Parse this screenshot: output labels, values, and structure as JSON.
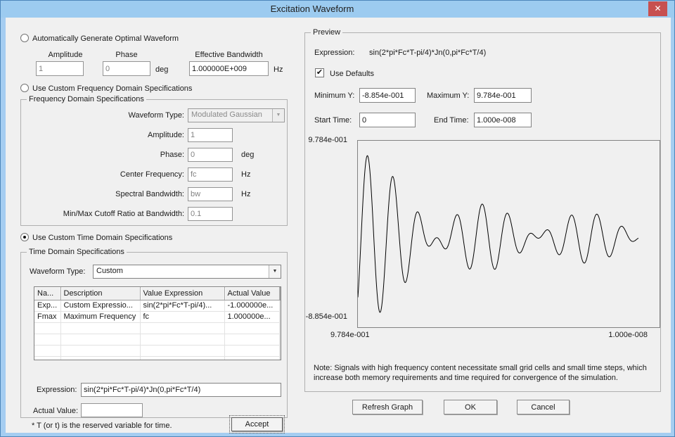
{
  "window": {
    "title": "Excitation Waveform"
  },
  "icons": {
    "close": "✕",
    "dropdown_arrow": "▼",
    "check": "✔"
  },
  "auto_section": {
    "radio_label": "Automatically Generate Optimal Waveform",
    "radio_selected": false,
    "amplitude_label": "Amplitude",
    "amplitude_value": "1",
    "phase_label": "Phase",
    "phase_value": "0",
    "deg_unit": "deg",
    "bandwidth_label": "Effective Bandwidth",
    "bandwidth_value": "1.000000E+009",
    "hz_unit": "Hz"
  },
  "freq_section": {
    "radio_label": "Use Custom Frequency Domain Specifications",
    "radio_selected": false,
    "group_title": "Frequency Domain Specifications",
    "waveform_type_label": "Waveform Type:",
    "waveform_type_value": "Modulated Gaussian",
    "amplitude_label": "Amplitude:",
    "amplitude_value": "1",
    "phase_label": "Phase:",
    "phase_value": "0",
    "phase_unit": "deg",
    "center_freq_label": "Center Frequency:",
    "center_freq_value": "fc",
    "center_freq_unit": "Hz",
    "spectral_bw_label": "Spectral Bandwidth:",
    "spectral_bw_value": "bw",
    "spectral_bw_unit": "Hz",
    "cutoff_label": "Min/Max Cutoff Ratio at Bandwidth:",
    "cutoff_value": "0.1"
  },
  "time_section": {
    "radio_label": "Use Custom Time Domain Specifications",
    "radio_selected": true,
    "group_title": "Time Domain Specifications",
    "waveform_type_label": "Waveform Type:",
    "waveform_type_value": "Custom",
    "table": {
      "columns": [
        "Na...",
        "Description",
        "Value Expression",
        "Actual Value"
      ],
      "rows": [
        [
          "Exp...",
          "Custom Expressio...",
          "sin(2*pi*Fc*T-pi/4)...",
          "-1.000000e..."
        ],
        [
          "Fmax",
          "Maximum Frequency",
          "fc",
          "1.000000e..."
        ]
      ],
      "empty_filler_rows": 5
    },
    "expression_label": "Expression:",
    "expression_value": "sin(2*pi*Fc*T-pi/4)*Jn(0,pi*Fc*T/4)",
    "actual_value_label": "Actual Value:",
    "actual_value_value": "",
    "footnote": "* T (or t) is the reserved variable for time.",
    "accept_button": "Accept"
  },
  "preview": {
    "group_title": "Preview",
    "expression_label": "Expression:",
    "expression_value": "sin(2*pi*Fc*T-pi/4)*Jn(0,pi*Fc*T/4)",
    "use_defaults_label": "Use Defaults",
    "use_defaults_checked": true,
    "min_y_label": "Minimum Y:",
    "min_y_value": "-8.854e-001",
    "max_y_label": "Maximum Y:",
    "max_y_value": "9.784e-001",
    "start_time_label": "Start Time:",
    "start_time_value": "0",
    "end_time_label": "End Time:",
    "end_time_value": "1.000e-008",
    "note_line1": "Note: Signals with high frequency content necessitate small grid cells and small time steps, which",
    "note_line2": "increase both memory requirements and time required for convergence of the simulation."
  },
  "buttons": {
    "refresh": "Refresh Graph",
    "ok": "OK",
    "cancel": "Cancel"
  },
  "chart_data": {
    "type": "line",
    "expression": "sin(2*pi*Fc*T-pi/4)*Jn(0,pi*Fc*T/4)",
    "x_axis": {
      "left_label": "9.784e-001",
      "right_label": "1.000e-008",
      "t_start": 0,
      "t_end": 1e-08
    },
    "y_axis": {
      "top_label": "9.784e-001",
      "bottom_label": "-8.854e-001"
    },
    "y_max": 0.9784,
    "y_min": -0.8854,
    "waveform": {
      "cycles": 11,
      "phase_rad": -0.7853981634,
      "bessel_order": 0,
      "bessel_arg_scale": 8.6393797974,
      "x_end_fraction": 0.93,
      "y_pad_fraction": 0.08,
      "samples": 800
    }
  }
}
